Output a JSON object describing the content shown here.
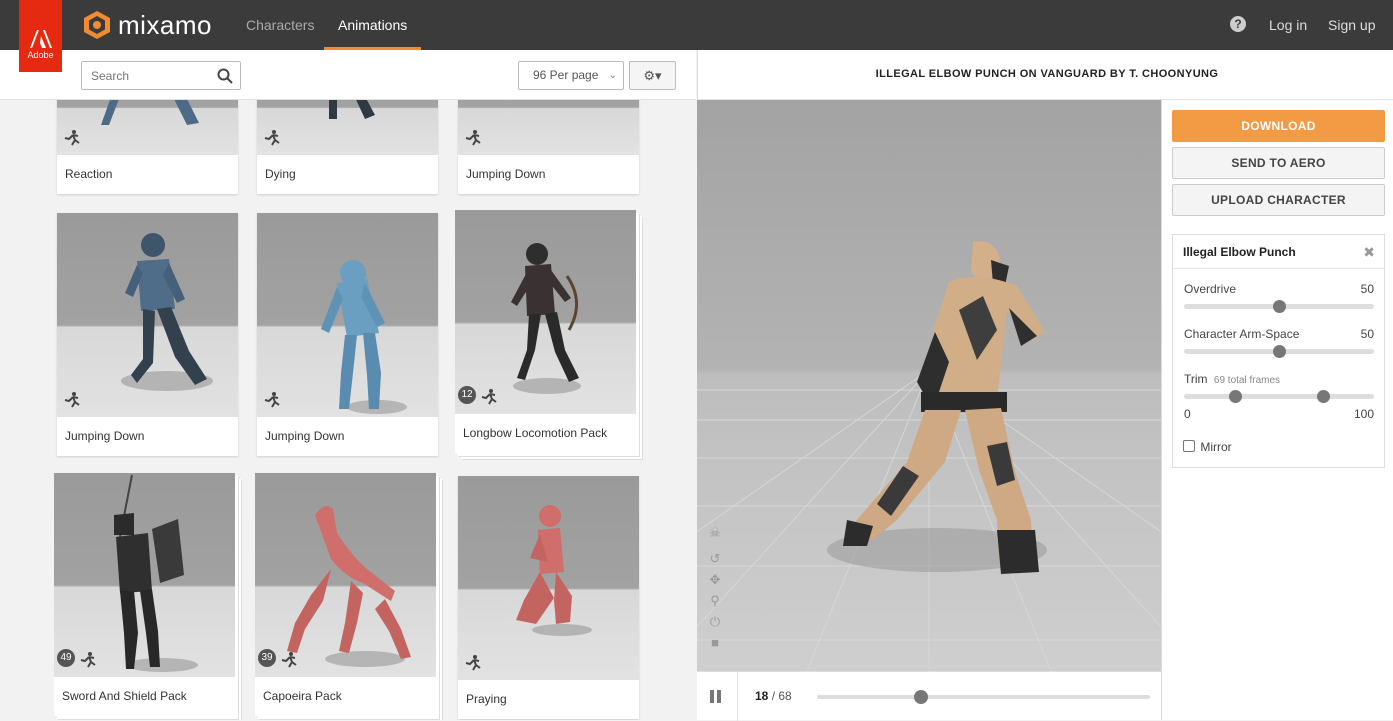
{
  "brand": {
    "adobe_label": "Adobe",
    "name": "mixamo"
  },
  "nav": {
    "characters": "Characters",
    "animations": "Animations",
    "help": "?",
    "login": "Log in",
    "signup": "Sign up"
  },
  "toolbar": {
    "search_placeholder": "Search",
    "per_page": "96 Per page"
  },
  "viewer": {
    "title": "ILLEGAL ELBOW PUNCH ON VANGUARD BY T. CHOONYUNG"
  },
  "cards": [
    {
      "caption": "Reaction",
      "count": ""
    },
    {
      "caption": "Dying",
      "count": ""
    },
    {
      "caption": "Jumping Down",
      "count": ""
    },
    {
      "caption": "Jumping Down",
      "count": ""
    },
    {
      "caption": "Jumping Down",
      "count": ""
    },
    {
      "caption": "Longbow Locomotion Pack",
      "count": "12"
    },
    {
      "caption": "Sword And Shield Pack",
      "count": "49"
    },
    {
      "caption": "Capoeira Pack",
      "count": "39"
    },
    {
      "caption": "Praying",
      "count": ""
    }
  ],
  "playback": {
    "current_frame": "18",
    "total": "/ 68",
    "progress": 0.29
  },
  "panel": {
    "download": "DOWNLOAD",
    "send_to_aero": "SEND TO AERO",
    "upload_character": "UPLOAD CHARACTER",
    "settings_title": "Illegal Elbow Punch",
    "overdrive_label": "Overdrive",
    "overdrive_value": "50",
    "overdrive_level": 0.5,
    "armspace_label": "Character Arm-Space",
    "armspace_value": "50",
    "armspace_level": 0.5,
    "trim_label": "Trim",
    "trim_note": "69 total frames",
    "trim_low": "0",
    "trim_high": "100",
    "trim_range": [
      0.27,
      0.73
    ],
    "mirror_label": "Mirror"
  },
  "colors": {
    "accent": "#f28c33",
    "adobe_red": "#e62a12",
    "topbar": "#3b3b3b",
    "download": "#f39a45"
  }
}
